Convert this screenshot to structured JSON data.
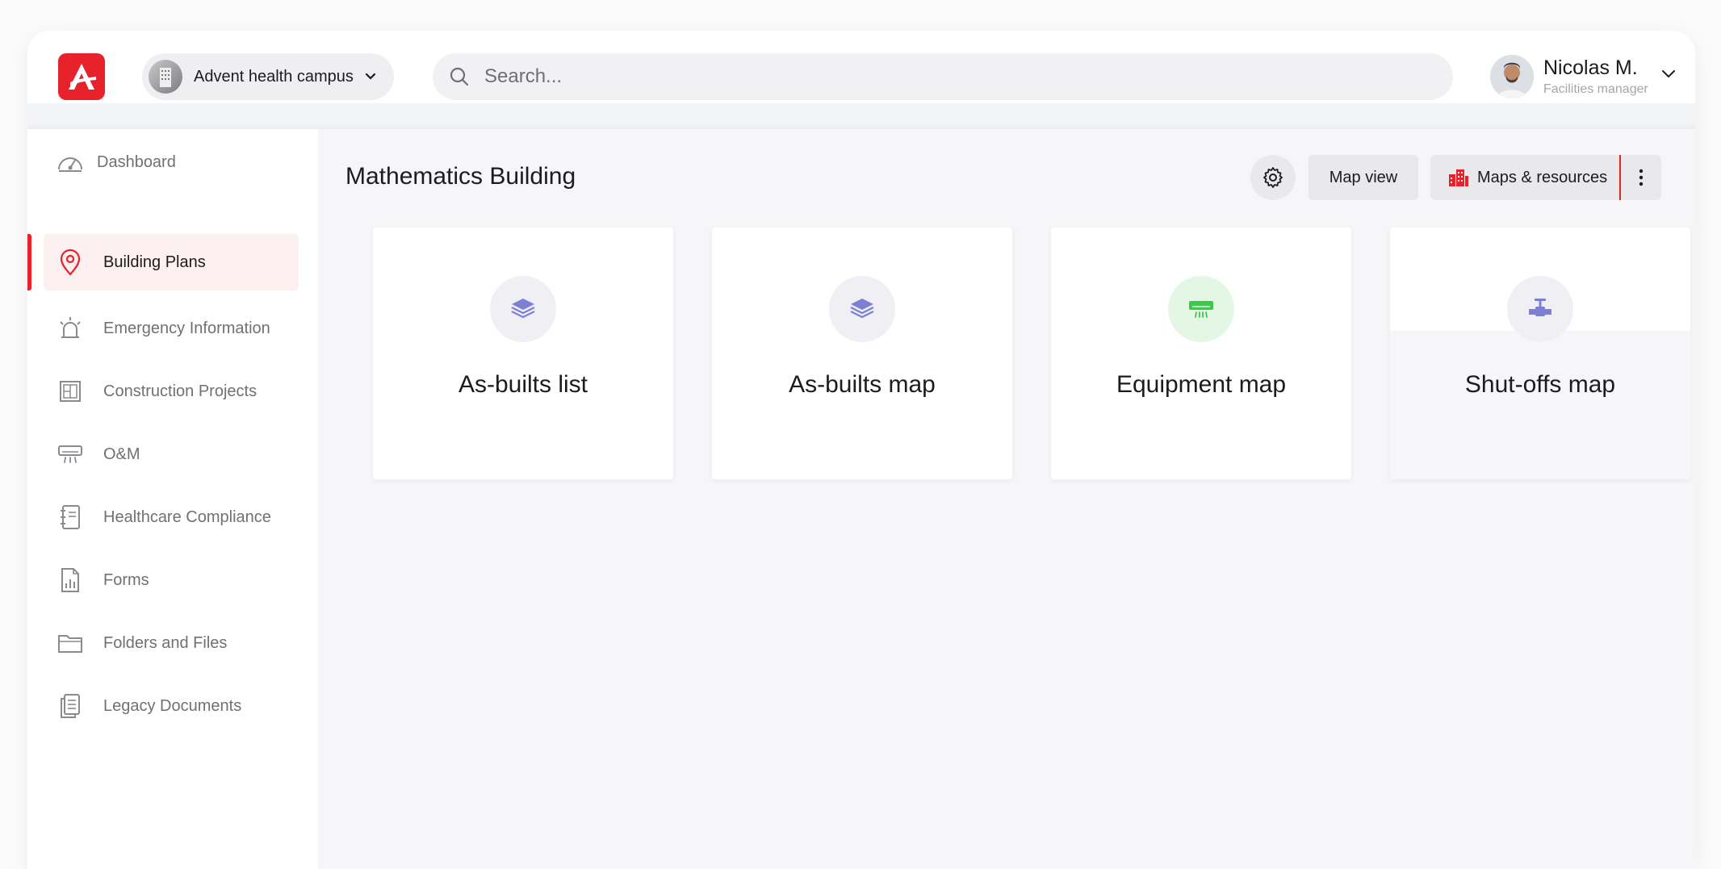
{
  "header": {
    "campus_label": "Advent health campus",
    "search_placeholder": "Search...",
    "user": {
      "name": "Nicolas M.",
      "role": "Facilities manager"
    }
  },
  "sidebar": {
    "items": [
      {
        "label": "Dashboard",
        "icon": "gauge-icon",
        "active": false
      },
      {
        "label": "Building Plans",
        "icon": "location-pin-icon",
        "active": true
      },
      {
        "label": "Emergency Information",
        "icon": "siren-icon",
        "active": false
      },
      {
        "label": "Construction Projects",
        "icon": "blueprint-icon",
        "active": false
      },
      {
        "label": "O&M",
        "icon": "air-conditioner-icon",
        "active": false
      },
      {
        "label": "Healthcare Compliance",
        "icon": "notebook-icon",
        "active": false
      },
      {
        "label": "Forms",
        "icon": "form-chart-icon",
        "active": false
      },
      {
        "label": "Folders and Files",
        "icon": "folder-icon",
        "active": false
      },
      {
        "label": "Legacy Documents",
        "icon": "documents-icon",
        "active": false
      }
    ]
  },
  "main": {
    "title": "Mathematics Building",
    "toolbar": {
      "map_view_label": "Map view",
      "maps_resources_label": "Maps & resources"
    },
    "cards": [
      {
        "label": "As-builts list",
        "icon": "layers-icon"
      },
      {
        "label": "As-builts map",
        "icon": "layers-icon"
      },
      {
        "label": "Equipment map",
        "icon": "air-conditioner-icon"
      },
      {
        "label": "Shut-offs map",
        "icon": "valve-icon"
      }
    ]
  },
  "colors": {
    "brand_red": "#e8222b",
    "icon_purple": "#7b7fd6",
    "icon_green": "#3cc84a"
  }
}
